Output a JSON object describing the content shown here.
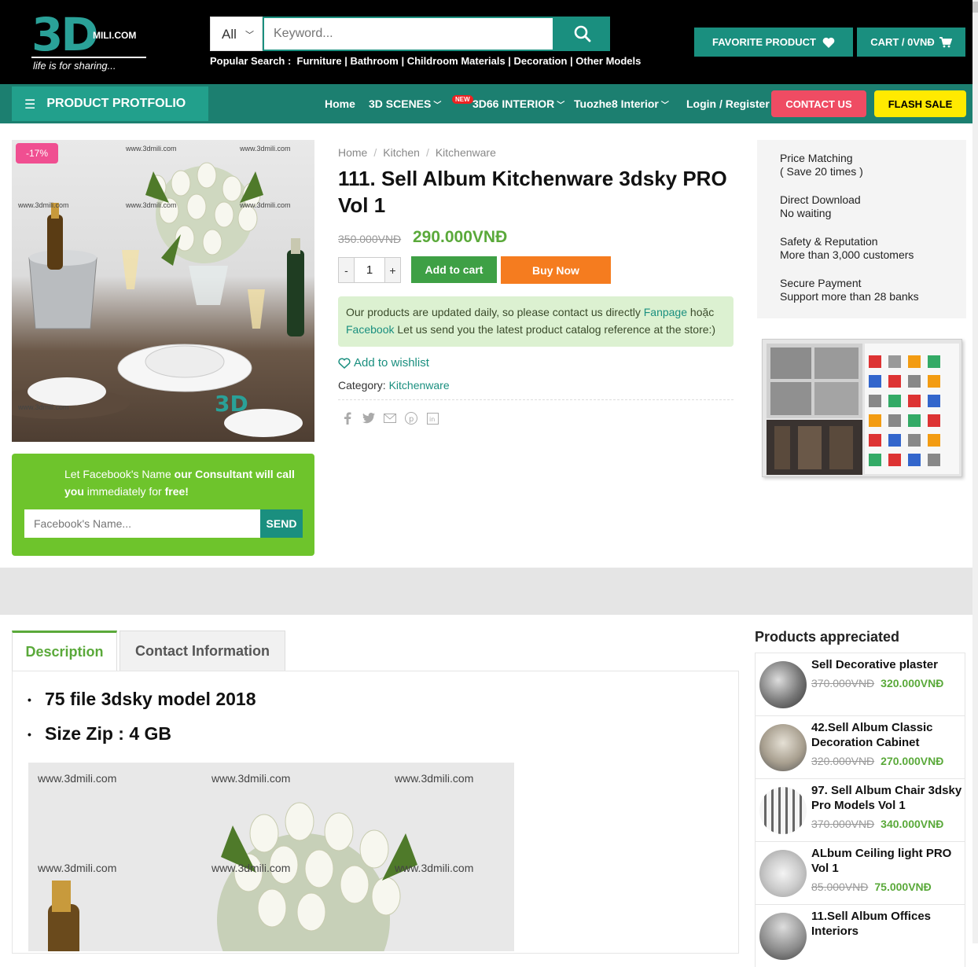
{
  "header": {
    "logo_main": "3D",
    "logo_domain": "MILI.COM",
    "logo_tagline": "life is for sharing...",
    "search_category": "All",
    "search_placeholder": "Keyword...",
    "popular_label": "Popular Search :",
    "popular_links": "Furniture | Bathroom | Childroom Materials | Decoration | Other Models",
    "favorite_label": "FAVORITE PRODUCT",
    "cart_label": "CART / 0VNĐ"
  },
  "nav": {
    "portfolio": "PRODUCT PROTFOLIO",
    "items": [
      "Home",
      "3D SCENES",
      "3D66 INTERIOR",
      "Tuozhe8 Interior",
      "Login / Register"
    ],
    "new_badge": "NEW",
    "contact": "CONTACT US",
    "flash": "FLASH SALE"
  },
  "product": {
    "sale_badge": "-17%",
    "watermark": "www.3dmili.com",
    "breadcrumb": [
      "Home",
      "Kitchen",
      "Kitchenware"
    ],
    "title": "111. Sell Album Kitchenware 3dsky PRO Vol 1",
    "old_price": "350.000VNĐ",
    "new_price": "290.000VNĐ",
    "qty_minus": "-",
    "qty": "1",
    "qty_plus": "+",
    "add_to_cart": "Add to cart",
    "buy_now": "Buy Now",
    "notice_1": "Our products are updated daily, so please contact us directly",
    "notice_fanpage": "Fanpage",
    "notice_hoac": "hoặc",
    "notice_facebook": "Facebook",
    "notice_2": "Let us send you the latest product catalog reference at the store:)",
    "wishlist": "Add to wishlist",
    "category_label": "Category:",
    "category_value": "Kitchenware"
  },
  "facebook_box": {
    "text_1": "Let Facebook's Name",
    "text_2": "our Consultant will call",
    "text_3": "you",
    "text_4": "immediately for",
    "text_5": "free!",
    "placeholder": "Facebook's Name...",
    "send": "SEND"
  },
  "benefits": [
    {
      "line1": "Price Matching",
      "line2": "( Save 20 times )"
    },
    {
      "line1": "Direct Download",
      "line2": "No waiting"
    },
    {
      "line1": "Safety & Reputation",
      "line2": "More than 3,000 customers"
    },
    {
      "line1": "Secure Payment",
      "line2": "Support more than 28 banks"
    }
  ],
  "tabs": {
    "description": "Description",
    "contact": "Contact Information",
    "bullet_1": "75 file 3dsky model 2018",
    "bullet_2": "Size Zip :  4 GB"
  },
  "appreciated": {
    "title": "Products appreciated",
    "items": [
      {
        "name": "Sell Decorative plaster",
        "old": "370.000VNĐ",
        "new": "320.000VNĐ"
      },
      {
        "name": "42.Sell Album Classic Decoration Cabinet",
        "old": "320.000VNĐ",
        "new": "270.000VNĐ"
      },
      {
        "name": "97. Sell Album Chair 3dsky Pro Models Vol 1",
        "old": "370.000VNĐ",
        "new": "340.000VNĐ"
      },
      {
        "name": "ALbum Ceiling light PRO Vol 1",
        "old": "85.000VNĐ",
        "new": "75.000VNĐ"
      },
      {
        "name": "11.Sell Album Offices Interiors",
        "old": "",
        "new": ""
      }
    ]
  },
  "colors": {
    "brand": "#1a8f7f",
    "price_green": "#5aa93a",
    "buy_orange": "#f57c1f",
    "contact_pink": "#ef4c63",
    "flash_yellow": "#ffea00"
  }
}
